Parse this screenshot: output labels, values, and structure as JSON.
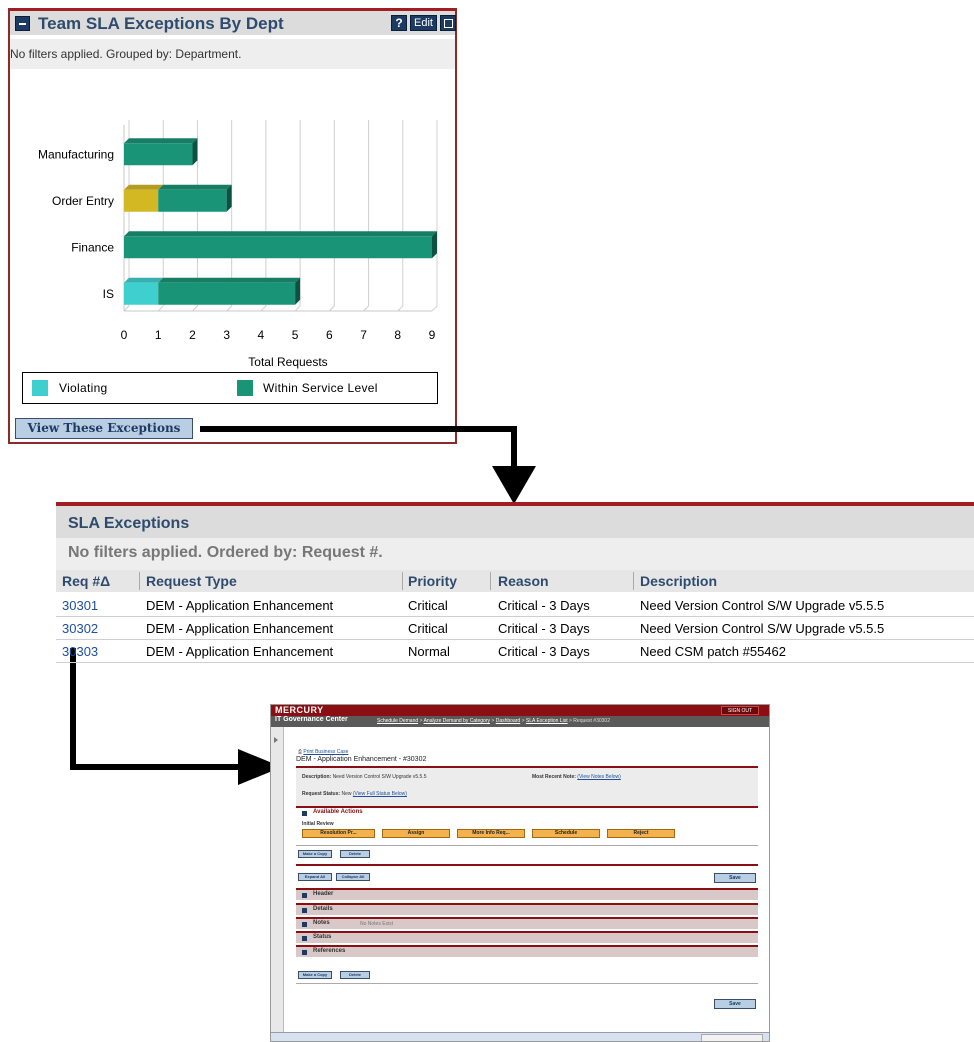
{
  "portlet": {
    "title": "Team SLA Exceptions By Dept",
    "help_label": "?",
    "edit_label": "Edit",
    "filter_text": "No filters applied. Grouped by: Department.",
    "view_button": "View These Exceptions",
    "legend": [
      {
        "label": "Violating",
        "color": "#3fcfcf"
      },
      {
        "label": "Within Service Level",
        "color": "#1a9477"
      }
    ]
  },
  "chart_data": {
    "type": "bar",
    "orientation": "horizontal",
    "stacked": true,
    "title": "",
    "xlabel": "Total Requests",
    "ylabel": "",
    "categories": [
      "Manufacturing",
      "Order Entry",
      "Finance",
      "IS"
    ],
    "xlim": [
      0,
      9
    ],
    "xticks": [
      0,
      1,
      2,
      3,
      4,
      5,
      6,
      7,
      8,
      9
    ],
    "grid": true,
    "legend_position": "bottom",
    "series": [
      {
        "name": "Violating",
        "values": [
          0,
          0,
          0,
          1
        ],
        "color": "#3fcfcf"
      },
      {
        "name": "",
        "values": [
          0,
          1,
          0,
          0
        ],
        "color": "#d4b823"
      },
      {
        "name": "Within Service Level",
        "values": [
          2,
          2,
          9,
          4
        ],
        "color": "#1a9477"
      }
    ]
  },
  "sla": {
    "title": "SLA Exceptions",
    "filter_text": "No filters applied. Ordered by: Request #.",
    "columns": [
      "Req #Δ",
      "Request Type",
      "Priority",
      "Reason",
      "Description"
    ],
    "rows": [
      {
        "req": "30301",
        "type": "DEM - Application Enhancement",
        "priority": "Critical",
        "reason": "Critical - 3 Days",
        "desc": "Need Version Control S/W Upgrade v5.5.5"
      },
      {
        "req": "30302",
        "type": "DEM - Application Enhancement",
        "priority": "Critical",
        "reason": "Critical - 3 Days",
        "desc": "Need Version Control S/W Upgrade v5.5.5"
      },
      {
        "req": "30303",
        "type": "DEM - Application Enhancement",
        "priority": "Normal",
        "reason": "Critical - 3 Days",
        "desc": "Need CSM patch #55462"
      }
    ]
  },
  "shot": {
    "brand": "MERCURY",
    "signout": "SIGN OUT",
    "app_title": "IT Governance Center",
    "crumbs": [
      "Schedule Demand",
      "Analyze Demand by Category",
      "Dashboard",
      "SLA Exception List"
    ],
    "crumb_current": "Request #30302",
    "print_link": "Print Business Case",
    "request_title": "DEM - Application Enhancement - #30302",
    "description_label": "Description:",
    "description_value": "Need Version Control S/W Upgrade v5.5.5",
    "recent_note_label": "Most Recent Note:",
    "recent_note_link": "(View Notes Below)",
    "status_label": "Request Status:",
    "status_value": "New",
    "status_link": "(View Full Status Below)",
    "available_actions": "Available Actions",
    "initial_review": "Initial Review",
    "action_buttons": [
      "Resolution Pr...",
      "Assign",
      "More Info Req...",
      "Schedule",
      "Reject"
    ],
    "make_copy": "Make a Copy",
    "delete": "Delete",
    "expand_all": "Expand All",
    "collapse_all": "Collapse All",
    "save": "Save",
    "sections": [
      "Header",
      "Details",
      "Notes",
      "Status",
      "References"
    ],
    "notes_empty": "No Notes Exist"
  }
}
